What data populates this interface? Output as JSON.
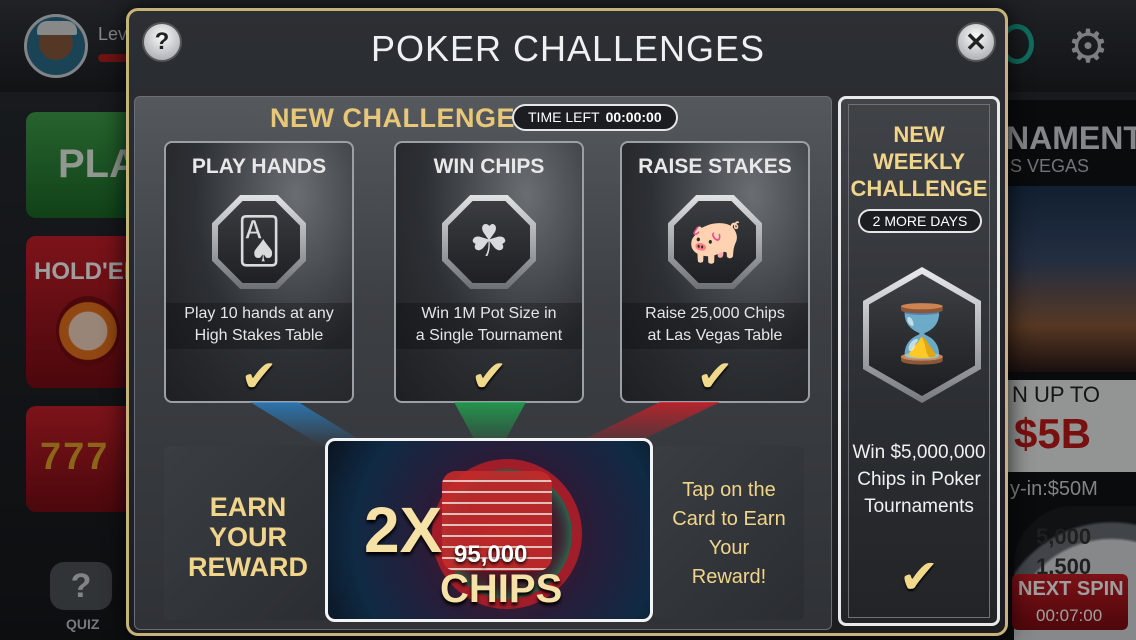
{
  "background": {
    "username": "Lev",
    "tiles": {
      "play": "PLA",
      "holdem": "HOLD'EM",
      "slots": "777"
    },
    "quiz_label": "QUIZ",
    "quiz_icon": "?",
    "gear_icon": "⚙",
    "right_panel": {
      "title": "NAMENT",
      "subtitle": "S VEGAS",
      "upto": "N UP TO",
      "amount": "$5B",
      "buyin": "y-in:$50M",
      "wheel_values": [
        "5,000",
        "1,500"
      ],
      "next_spin_label": "NEXT SPIN",
      "next_spin_countdown": "00:07:00"
    }
  },
  "modal": {
    "title": "POKER CHALLENGES",
    "help_icon": "?",
    "close_icon": "✕",
    "section_title": "NEW CHALLENGES",
    "time_left_label": "TIME LEFT",
    "time_left_value": "00:00:00",
    "challenges": [
      {
        "title": "PLAY HANDS",
        "icon": "cards-icon",
        "glyph": "🂡",
        "desc1": "Play 10 hands at any",
        "desc2": "High Stakes Table",
        "check": "✔"
      },
      {
        "title": "WIN CHIPS",
        "icon": "clover-icon",
        "glyph": "☘",
        "desc1": "Win 1M Pot Size in",
        "desc2": "a Single Tournament",
        "check": "✔"
      },
      {
        "title": "RAISE STAKES",
        "icon": "piggy-bank-icon",
        "glyph": "🐖",
        "desc1": "Raise 25,000 Chips",
        "desc2": "at Las Vegas Table",
        "check": "✔"
      }
    ],
    "earn_reward": {
      "l1": "EARN",
      "l2": "YOUR",
      "l3": "REWARD"
    },
    "reward_card": {
      "multiplier": "2X",
      "amount": "95,000",
      "unit": "CHIPS"
    },
    "tap_hint": {
      "l1": "Tap on the",
      "l2": "Card to Earn",
      "l3": "Your",
      "l4": "Reward!"
    },
    "weekly": {
      "l1": "NEW",
      "l2": "WEEKLY",
      "l3": "CHALLENGE",
      "days_left": "2 MORE DAYS",
      "icon": "hourglass-icon",
      "glyph": "⌛",
      "desc1": "Win $5,000,000",
      "desc2": "Chips in Poker",
      "desc3": "Tournaments",
      "check": "✔"
    }
  }
}
